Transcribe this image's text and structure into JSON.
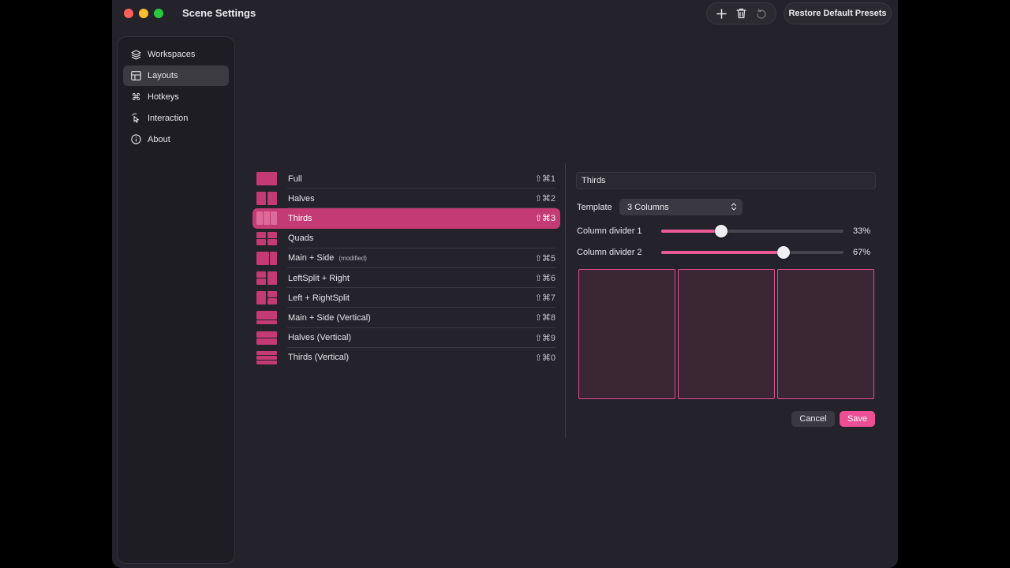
{
  "window": {
    "title": "Scene Settings"
  },
  "toolbar": {
    "icons": [
      "plus-icon",
      "trash-icon",
      "undo-icon"
    ],
    "restore_label": "Restore Default Presets"
  },
  "sidebar": {
    "items": [
      {
        "label": "Workspaces",
        "icon": "stack-icon",
        "active": false
      },
      {
        "label": "Layouts",
        "icon": "grid-icon",
        "active": true
      },
      {
        "label": "Hotkeys",
        "icon": "command-icon",
        "active": false
      },
      {
        "label": "Interaction",
        "icon": "pointer-icon",
        "active": false
      },
      {
        "label": "About",
        "icon": "info-icon",
        "active": false
      }
    ]
  },
  "layouts": [
    {
      "name": "Full",
      "shortcut": "⇧⌘1",
      "modified": "",
      "selected": false
    },
    {
      "name": "Halves",
      "shortcut": "⇧⌘2",
      "modified": "",
      "selected": false
    },
    {
      "name": "Thirds",
      "shortcut": "⇧⌘3",
      "modified": "",
      "selected": true
    },
    {
      "name": "Quads",
      "shortcut": "",
      "modified": "",
      "selected": false
    },
    {
      "name": "Main + Side",
      "shortcut": "⇧⌘5",
      "modified": "(modified)",
      "selected": false
    },
    {
      "name": "LeftSplit + Right",
      "shortcut": "⇧⌘6",
      "modified": "",
      "selected": false
    },
    {
      "name": "Left + RightSplit",
      "shortcut": "⇧⌘7",
      "modified": "",
      "selected": false
    },
    {
      "name": "Main + Side (Vertical)",
      "shortcut": "⇧⌘8",
      "modified": "",
      "selected": false
    },
    {
      "name": "Halves (Vertical)",
      "shortcut": "⇧⌘9",
      "modified": "",
      "selected": false
    },
    {
      "name": "Thirds (Vertical)",
      "shortcut": "⇧⌘0",
      "modified": "",
      "selected": false
    }
  ],
  "editor": {
    "name_value": "Thirds",
    "template_label": "Template",
    "template_value": "3 Columns",
    "dividers": [
      {
        "label": "Column divider 1",
        "value": 0.33,
        "value_text": "33%"
      },
      {
        "label": "Column divider 2",
        "value": 0.67,
        "value_text": "67%"
      }
    ],
    "preview_columns": 3,
    "cancel_label": "Cancel",
    "save_label": "Save"
  },
  "colors": {
    "accent": "#c33a74",
    "save": "#ec4f94",
    "background": "#24222a"
  }
}
